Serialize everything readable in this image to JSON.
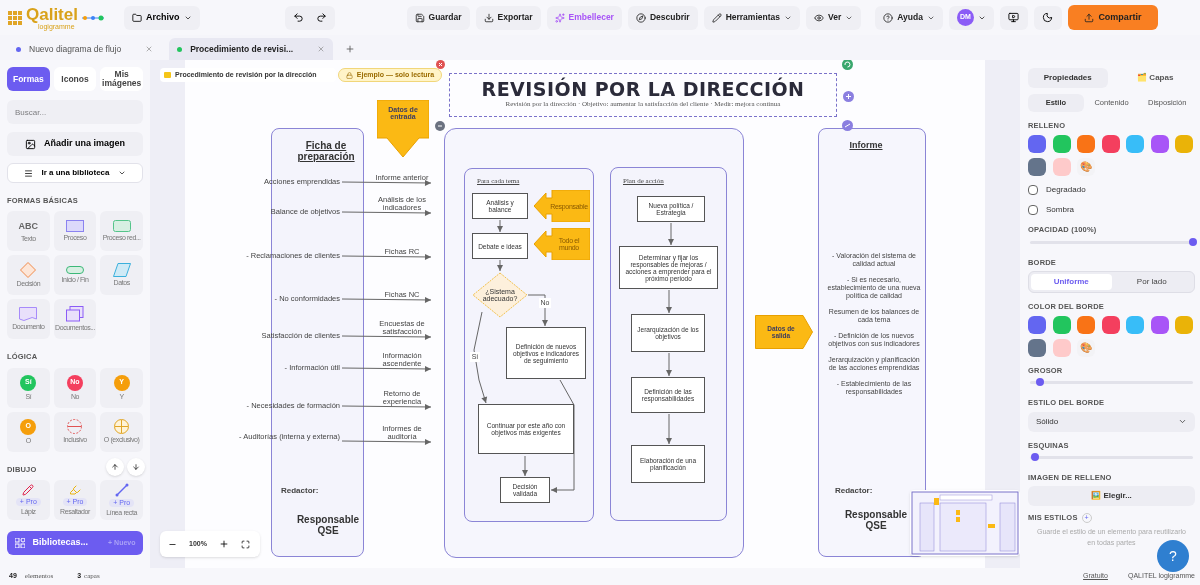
{
  "header": {
    "logo": "Qalitel",
    "logo_sub": "logigramme",
    "file_menu": "Archivo",
    "actions": [
      {
        "label": "Guardar",
        "kind": "save"
      },
      {
        "label": "Exportar",
        "kind": "export"
      },
      {
        "label": "Embellecer",
        "kind": "magic"
      },
      {
        "label": "Descubrir",
        "kind": "discover"
      },
      {
        "label": "Herramientas",
        "kind": "tools"
      },
      {
        "label": "Ver",
        "kind": "view"
      },
      {
        "label": "Ayuda",
        "kind": "help"
      }
    ],
    "avatar": "DM",
    "share": "Compartir"
  },
  "doc_tabs": [
    {
      "label": "Nuevo diagrama de flujo",
      "color": "#6366f1",
      "selected": false
    },
    {
      "label": "Procedimiento de revisi...",
      "color": "#22c55e",
      "selected": true
    }
  ],
  "sidebar": {
    "tabs": [
      {
        "label": "Formas",
        "selected": true
      },
      {
        "label": "Iconos",
        "selected": false
      },
      {
        "label": "Mis imágenes",
        "selected": false
      }
    ],
    "search": {
      "placeholder": "Buscar..."
    },
    "add_image": "Añadir una imagen",
    "library": "Ir a una biblioteca",
    "sections": [
      {
        "title": "FORMAS BÁSICAS",
        "shapes": [
          {
            "kind": "text",
            "glyph": "ABC",
            "label": "Texto"
          },
          {
            "kind": "process",
            "label": "Proceso"
          },
          {
            "kind": "rounded",
            "label": "Proceso red..."
          },
          {
            "kind": "decision",
            "label": "Decisión"
          },
          {
            "kind": "terminal",
            "label": "Inicio / Fin"
          },
          {
            "kind": "data",
            "label": "Datos"
          },
          {
            "kind": "document",
            "label": "Documento"
          },
          {
            "kind": "documents",
            "label": "Documentos..."
          }
        ]
      },
      {
        "title": "LÓGICA",
        "shapes": [
          {
            "kind": "circle",
            "glyph": "Sí",
            "color": "#22c55e",
            "label": "Sí"
          },
          {
            "kind": "circle",
            "glyph": "No",
            "color": "#f43f5e",
            "label": "No"
          },
          {
            "kind": "circle",
            "glyph": "Y",
            "color": "#f59e0b",
            "label": "Y"
          },
          {
            "kind": "circle",
            "glyph": "O",
            "color": "#f59e0b",
            "label": "O"
          },
          {
            "kind": "dashed",
            "label": "Inclusivo"
          },
          {
            "kind": "cross",
            "label": "O (exclusivo)"
          }
        ]
      },
      {
        "title": "DIBUJO",
        "shapes": [
          {
            "kind": "pencil",
            "badge": "+ Pro",
            "label": "Lápiz"
          },
          {
            "kind": "marker",
            "badge": "+ Pro",
            "label": "Resaltador"
          },
          {
            "kind": "line",
            "badge": "+ Pro",
            "label": "Línea recta"
          }
        ]
      }
    ],
    "libraries": "Bibliotecas...",
    "libraries_new": "+ Nuevo"
  },
  "canvas": {
    "breadcrumb": "Procedimiento de revisión por la dirección",
    "badge": "Ejemplo — solo lectura",
    "title": "REVISIÓN POR LA DIRECCIÓN",
    "subtitle": "Revisión por la dirección · Objetivo: aumentar la satisfacción del cliente · Medir: mejora continua",
    "input_arrow": "Datos de entrada",
    "left_lane": {
      "heading": "Ficha de preparación",
      "rows": [
        {
          "label": "Acciones emprendidas",
          "flow": "Informe anterior"
        },
        {
          "label": "Balance de objetivos",
          "flow": "Análisis de los indicadores"
        },
        {
          "label": "- Reclamaciones de clientes",
          "flow": "Fichas RC"
        },
        {
          "label": "- No conformidades",
          "flow": "Fichas NC"
        },
        {
          "label": "Satisfacción de clientes",
          "flow": "Encuestas de satisfacción"
        },
        {
          "label": "- Información útil",
          "flow": "Información ascendente"
        },
        {
          "label": "- Necesidades de formación",
          "flow": "Retorno de experiencia"
        },
        {
          "label": "- Auditorías (interna y externa)",
          "flow": "Informes de auditoría"
        }
      ],
      "footer_label": "Redactor:",
      "footer": "Responsable QSE"
    },
    "sub_lanes": [
      {
        "heading": "Para cada tema",
        "nodes": [
          {
            "kind": "box",
            "text": "Análisis y balance"
          },
          {
            "kind": "box",
            "text": "Debate e ideas"
          },
          {
            "kind": "callout",
            "text": "Responsable"
          },
          {
            "kind": "callout",
            "text": "Todo el mundo"
          },
          {
            "kind": "decision",
            "text": "¿Sistema adecuado?"
          },
          {
            "kind": "label",
            "text": "No"
          },
          {
            "kind": "label",
            "text": "Sí"
          },
          {
            "kind": "box",
            "text": "Definición de nuevos objetivos e indicadores de seguimiento"
          },
          {
            "kind": "box",
            "text": "Continuar por este año con objetivos más exigentes"
          },
          {
            "kind": "box",
            "text": "Decisión validada"
          }
        ]
      },
      {
        "heading": "Plan de acción",
        "nodes": [
          {
            "kind": "box",
            "text": "Nueva política / Estrategia"
          },
          {
            "kind": "box",
            "text": "Determinar y fijar los responsables de mejoras / acciones a emprender para el próximo periodo"
          },
          {
            "kind": "box",
            "text": "Jerarquización de los objetivos"
          },
          {
            "kind": "box",
            "text": "Definición de las responsabilidades"
          },
          {
            "kind": "box",
            "text": "Elaboración de una planificación"
          }
        ]
      }
    ],
    "output_arrow": "Datos de salida",
    "report_lane": {
      "heading": "Informe",
      "items": [
        "- Valoración del sistema de calidad actual",
        "- Si es necesario, establecimiento de una nueva política de calidad",
        "Resumen de los balances de cada tema",
        "- Definición de los nuevos objetivos con sus indicadores",
        "Jerarquización y planificación de las acciones emprendidas",
        "- Establecimiento de las responsabilidades"
      ],
      "footer_label": "Redactor:",
      "footer": "Responsable QSE"
    },
    "zoom": "100%"
  },
  "properties": {
    "tabs": [
      {
        "label": "Propiedades",
        "selected": true
      },
      {
        "label": "🗂️ Capas",
        "selected": false
      }
    ],
    "subtabs": [
      {
        "label": "Estilo",
        "selected": true
      },
      {
        "label": "Contenido",
        "selected": false
      },
      {
        "label": "Disposición",
        "selected": false
      }
    ],
    "fill": {
      "title": "RELLENO",
      "swatches": [
        {
          "kind": "color",
          "color": "#6366f1"
        },
        {
          "kind": "color",
          "color": "#22c55e"
        },
        {
          "kind": "color",
          "color": "#f97316"
        },
        {
          "kind": "color",
          "color": "#f43f5e"
        },
        {
          "kind": "color",
          "color": "#38bdf8"
        },
        {
          "kind": "color",
          "color": "#a855f7"
        },
        {
          "kind": "color",
          "color": "#eab308"
        },
        {
          "kind": "color",
          "color": "#64748b"
        },
        {
          "kind": "color",
          "color": "#fecaca"
        },
        {
          "kind": "palette",
          "glyph": "🎨"
        }
      ]
    },
    "checks": [
      {
        "label": "Degradado",
        "checked": false
      },
      {
        "label": "Sombra",
        "checked": false
      }
    ],
    "opacity": {
      "title": "OPACIDAD (100%)",
      "level": 1
    },
    "border": {
      "title": "BORDE",
      "options": [
        {
          "label": "Uniforme",
          "selected": true
        },
        {
          "label": "Por lado",
          "selected": false
        }
      ]
    },
    "border_color": {
      "title": "COLOR DEL BORDE",
      "swatches": [
        {
          "kind": "color",
          "color": "#6366f1"
        },
        {
          "kind": "color",
          "color": "#22c55e"
        },
        {
          "kind": "color",
          "color": "#f97316"
        },
        {
          "kind": "color",
          "color": "#f43f5e"
        },
        {
          "kind": "color",
          "color": "#38bdf8"
        },
        {
          "kind": "color",
          "color": "#a855f7"
        },
        {
          "kind": "color",
          "color": "#eab308"
        },
        {
          "kind": "color",
          "color": "#64748b"
        },
        {
          "kind": "color",
          "color": "#fecaca"
        },
        {
          "kind": "palette",
          "glyph": "🎨"
        }
      ]
    },
    "thickness": {
      "title": "GROSOR",
      "level": 0.06
    },
    "border_style": {
      "title": "ESTILO DEL BORDE",
      "value": "Sólido"
    },
    "corners": {
      "title": "ESQUINAS",
      "level": 0.03
    },
    "fill_image": {
      "title": "IMAGEN DE RELLENO",
      "button": "🖼️ Elegir..."
    },
    "my_styles": {
      "title": "MIS ESTILOS",
      "add": "+",
      "hint": "Guarde el estilo de un elemento para reutilizarlo en todas partes"
    }
  },
  "help_button": "?",
  "status_bar": {
    "elements": "49",
    "elements_label": "elementos",
    "layers": "3",
    "layers_label": "capas",
    "plan": "Gratuito",
    "brand": "QALITEL logigramme"
  }
}
